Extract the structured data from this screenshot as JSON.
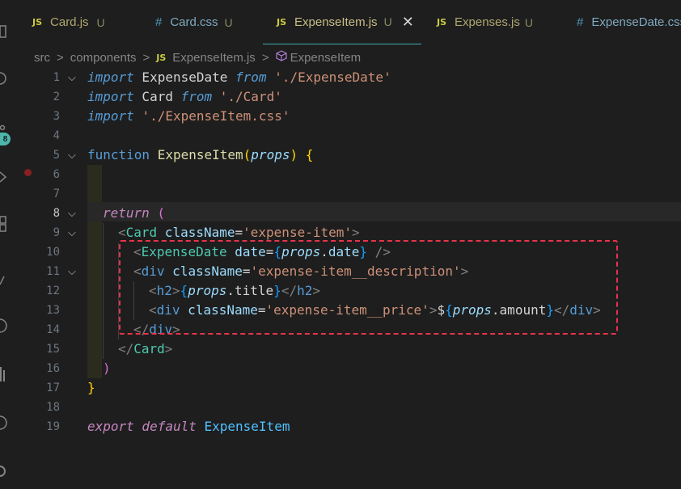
{
  "tabs": [
    {
      "icon": "JS",
      "name": "Card.js",
      "status": "U"
    },
    {
      "icon": "#",
      "name": "Card.css",
      "status": "U"
    },
    {
      "icon": "JS",
      "name": "ExpenseItem.js",
      "status": "U",
      "close": "✕"
    },
    {
      "icon": "JS",
      "name": "Expenses.js",
      "status": "U"
    },
    {
      "icon": "#",
      "name": "ExpenseDate.css",
      "status": ""
    }
  ],
  "breadcrumb": {
    "parts": [
      "src",
      "components",
      "ExpenseItem.js",
      "ExpenseItem"
    ],
    "file_icon": "JS",
    "separator": ">"
  },
  "activity": {
    "badge": "8"
  },
  "editor": {
    "line_numbers": [
      "1",
      "2",
      "3",
      "4",
      "5",
      "6",
      "7",
      "8",
      "9",
      "10",
      "11",
      "12",
      "13",
      "14",
      "15",
      "16",
      "17",
      "18",
      "19"
    ],
    "lines": {
      "l1": {
        "kw": "import",
        "id": " ExpenseDate ",
        "kw2": "from",
        "sp": " ",
        "str": "'./ExpenseDate'"
      },
      "l2": {
        "kw": "import",
        "id": " Card ",
        "kw2": "from",
        "sp": " ",
        "str": "'./Card'"
      },
      "l3": {
        "kw": "import",
        "sp": " ",
        "str": "'./ExpenseItem.css'"
      },
      "l5": {
        "kw": "function",
        "fn": " ExpenseItem",
        "open": "(",
        "param": "props",
        "close": ")",
        "brace": " {"
      },
      "l8": {
        "kw": "return",
        "paren": " ("
      },
      "l9": {
        "lt": "<",
        "tag": "Card",
        "attr": " className",
        "eq": "=",
        "str": "'expense-item'",
        "gt": ">"
      },
      "l10": {
        "lt": "<",
        "tag": "ExpenseDate",
        "attr": " date",
        "eq": "=",
        "ob": "{",
        "param": "props",
        "dot": ".",
        "prop": "date",
        "cb": "}",
        "end": " />"
      },
      "l11": {
        "lt": "<",
        "tag": "div",
        "attr": " className",
        "eq": "=",
        "str": "'expense-item__description'",
        "gt": ">"
      },
      "l12": {
        "lt": "<",
        "tag": "h2",
        "gt": ">",
        "ob": "{",
        "param": "props",
        "dot": ".",
        "prop": "title",
        "cb": "}",
        "lt2": "</",
        "tag2": "h2",
        "gt2": ">"
      },
      "l13": {
        "lt": "<",
        "tag": "div",
        "attr": " className",
        "eq": "=",
        "str": "'expense-item__price'",
        "gt": ">",
        "dollar": "$",
        "ob": "{",
        "param": "props",
        "dot": ".",
        "prop": "amount",
        "cb": "}",
        "lt2": "</",
        "tag2": "div",
        "gt2": ">"
      },
      "l14": {
        "lt": "</",
        "tag": "div",
        "gt": ">"
      },
      "l15": {
        "lt": "</",
        "tag": "Card",
        "gt": ">"
      },
      "l16": {
        "paren": ")"
      },
      "l17": {
        "brace": "}"
      },
      "l19": {
        "kw": "export",
        "kw2": " default",
        "id": " ExpenseItem"
      }
    }
  },
  "colors": {
    "accent": "#3fb0a7",
    "highlight_box": "#e8334a",
    "breakpoint": "#8b1f1f"
  }
}
